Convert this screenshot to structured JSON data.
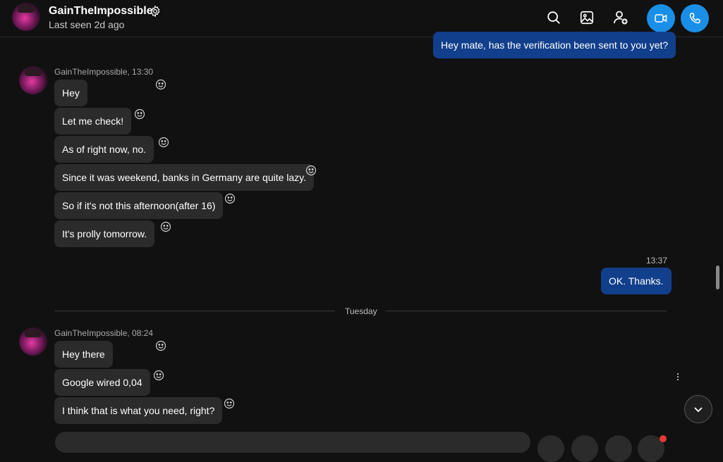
{
  "header": {
    "contact_name": "GainTheImpossible",
    "status": "Last seen 2d ago",
    "icons": [
      "gear-icon",
      "search-icon",
      "gallery-icon",
      "add-person-icon",
      "video-call-icon",
      "audio-call-icon"
    ],
    "accent_color": "#1a8fe8"
  },
  "messages": {
    "outgoing_1": "Hey mate, has the verification been sent to you yet?",
    "group_1": {
      "meta": "GainTheImpossible, 13:30",
      "items": [
        "Hey",
        "Let me check!",
        "As of right now, no.",
        "Since it was weekend, banks in Germany are quite lazy.",
        "So if it's not this afternoon(after 16)",
        "It's prolly tomorrow."
      ]
    },
    "outgoing_2": {
      "time": "13:37",
      "text": "OK. Thanks."
    },
    "day_divider": "Tuesday",
    "group_2": {
      "meta": "GainTheImpossible, 08:24",
      "items": [
        "Hey there",
        "Google wired 0,04",
        "I think that is what you need, right?"
      ]
    }
  },
  "colors": {
    "background": "#111111",
    "incoming_bubble": "#2b2b2b",
    "outgoing_bubble": "#123f8c",
    "call_button": "#1a8fe8"
  }
}
